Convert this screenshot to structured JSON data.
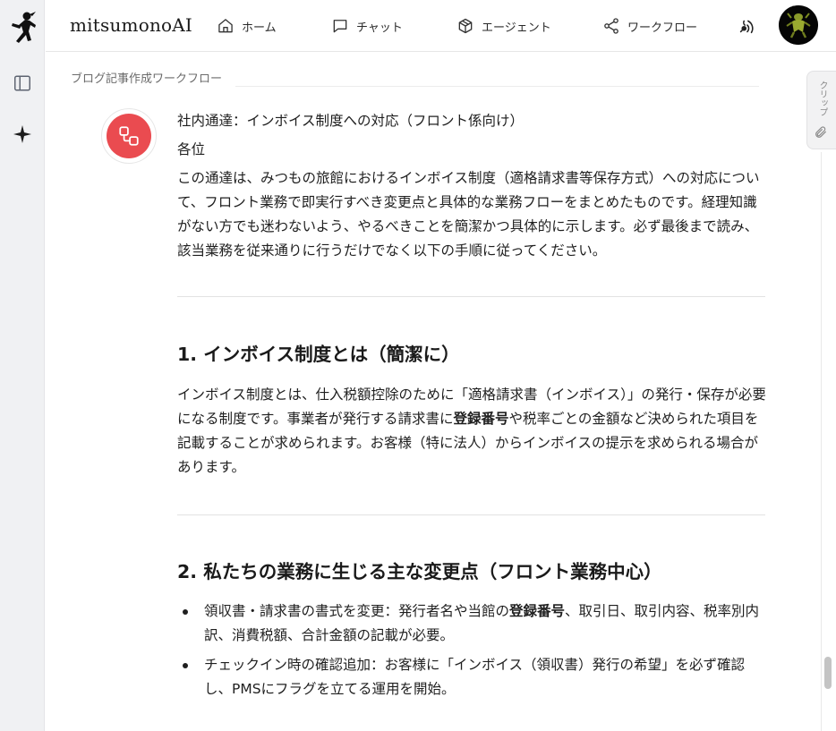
{
  "header": {
    "brand": "mitsumonoAI",
    "nav": {
      "home": "ホーム",
      "chat": "チャット",
      "agent": "エージェント",
      "workflow": "ワークフロー"
    }
  },
  "breadcrumb": "ブログ記事作成ワークフロー",
  "clip_tab": {
    "label": "クリップ"
  },
  "colors": {
    "bot_accent": "#ea4b50",
    "rail_bg": "#f0f1f3"
  },
  "message": {
    "subject": "社内通達：インボイス制度への対応（フロント係向け）",
    "greeting": "各位",
    "intro": "この通達は、みつもの旅館におけるインボイス制度（適格請求書等保存方式）への対応について、フロント業務で即実行すべき変更点と具体的な業務フローをまとめたものです。経理知識がない方でも迷わないよう、やるべきことを簡潔かつ具体的に示します。必ず最後まで読み、該当業務を従来通りに行うだけでなく以下の手順に従ってください。",
    "section1": {
      "heading": "1. インボイス制度とは（簡潔に）",
      "body_a": "インボイス制度とは、仕入税額控除のために「適格請求書（インボイス）」の発行・保存が必要になる制度です。事業者が発行する請求書に",
      "body_bold": "登録番号",
      "body_b": "や税率ごとの金額など決められた項目を記載することが求められます。お客様（特に法人）からインボイスの提示を求められる場合があります。"
    },
    "section2": {
      "heading": "2. 私たちの業務に生じる主な変更点（フロント業務中心）",
      "items": [
        {
          "a": "領収書・請求書の書式を変更：発行者名や当館の",
          "bold": "登録番号",
          "b": "、取引日、取引内容、税率別内訳、消費税額、合計金額の記載が必要。"
        },
        {
          "a": "チェックイン時の確認追加：お客様に「インボイス（領収書）発行の希望」を必ず確認し、PMSにフラグを立てる運用を開始。",
          "bold": "",
          "b": ""
        }
      ]
    }
  }
}
